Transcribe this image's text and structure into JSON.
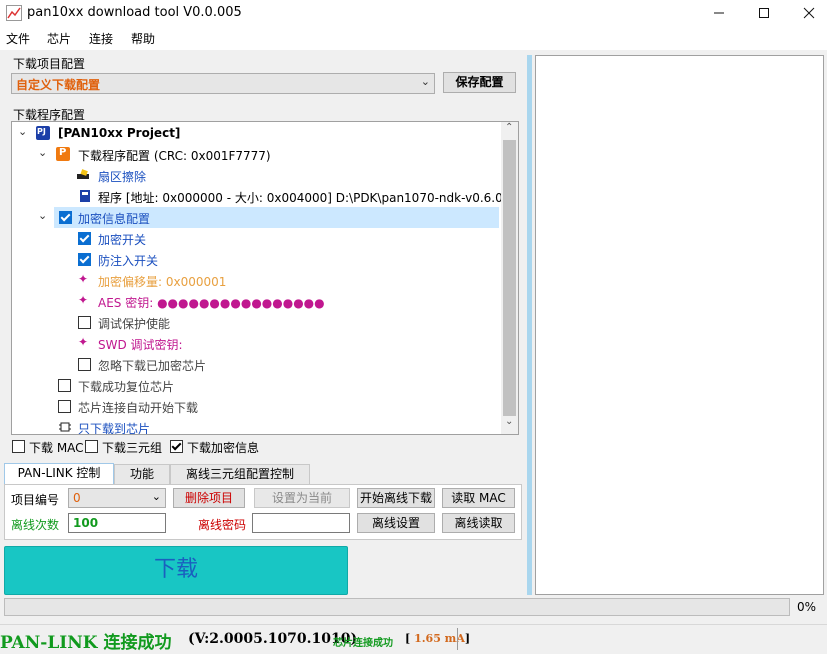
{
  "window": {
    "title": "pan10xx download tool V0.0.005"
  },
  "menu": [
    "文件",
    "芯片",
    "连接",
    "帮助"
  ],
  "download_project": {
    "group_label": "下载项目配置",
    "selected": "自定义下载配置",
    "save_label": "保存配置"
  },
  "program_config": {
    "group_label": "下载程序配置",
    "tree": {
      "project": "[PAN10xx Project]",
      "program_node": "下载程序配置 (CRC: 0x001F7777)",
      "sector_erase": "扇区擦除",
      "program_file": "程序 [地址: 0x000000 - 大小: 0x004000] D:\\PDK\\pan1070-ndk-v0.6.0...",
      "encrypt_config": "加密信息配置",
      "encrypt_switch": "加密开关",
      "anti_inject": "防注入开关",
      "encrypt_offset": "加密偏移量: 0x000001",
      "aes_key": "AES 密钥: ●●●●●●●●●●●●●●●●",
      "debug_protect": "调试保护使能",
      "swd_key": "SWD 调试密钥:",
      "ignore_encrypted": "忽略下载已加密芯片",
      "reset_after": "下载成功复位芯片",
      "auto_start": "芯片连接自动开始下载",
      "download_only": "只下载到芯片"
    },
    "checked": {
      "encrypt_config": true,
      "encrypt_switch": true,
      "anti_inject": true,
      "debug_protect": false,
      "ignore_encrypted": false,
      "reset_after": false,
      "auto_start": false
    }
  },
  "options": {
    "mac_label": "下载 MAC",
    "triple_label": "下载三元组",
    "encrypt_label": "下载加密信息",
    "mac_checked": false,
    "triple_checked": false,
    "encrypt_checked": true
  },
  "tabs": [
    "PAN-LINK 控制",
    "功能",
    "离线三元组配置控制"
  ],
  "panlink": {
    "project_no_label": "项目编号",
    "project_no_value": "0",
    "delete_project": "删除项目",
    "set_current": "设置为当前",
    "start_offline": "开始离线下载",
    "read_mac": "读取 MAC",
    "offline_count_label": "离线次数",
    "offline_count_value": "100",
    "offline_pwd_label": "离线密码",
    "offline_pwd_value": "",
    "offline_settings": "离线设置",
    "offline_read": "离线读取"
  },
  "download_button": "下载",
  "progress": {
    "percent": 0,
    "text": "0%"
  },
  "status": {
    "main": "PAN-LINK 连接成功",
    "version": "(V:2.0005.1070.1010)",
    "chip": "芯片连接成功",
    "current_prefix": "[",
    "current_value": "1.65 mA",
    "current_suffix": "]"
  },
  "colors": {
    "accent_orange": "#e0600c",
    "link_blue": "#1a4fbf",
    "success_green": "#119a1e",
    "download_btn": "#18c6c4",
    "magenta": "#c0178f",
    "offset_orange": "#e8a040"
  }
}
